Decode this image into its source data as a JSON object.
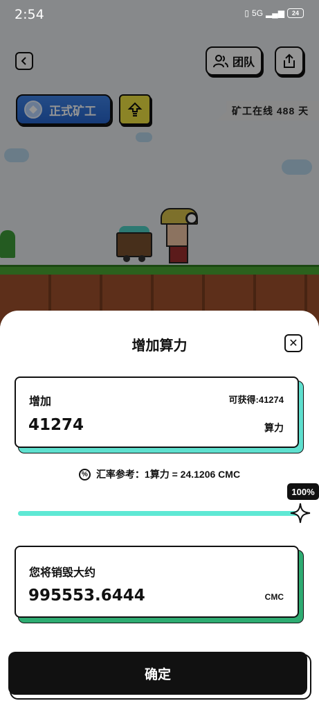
{
  "status_bar": {
    "time": "2:54",
    "network": "5G",
    "battery": "24"
  },
  "header": {
    "team_label": "团队",
    "miner_badge_label": "正式矿工",
    "online_text": "矿工在线 488 天"
  },
  "sheet": {
    "title": "增加算力",
    "add": {
      "label": "增加",
      "obtainable_text": "可获得:41274",
      "value": "41274",
      "unit": "算力"
    },
    "rate": {
      "icon": "%",
      "text": "汇率参考：1算力 = 24.1206 CMC"
    },
    "slider": {
      "percent_label": "100%",
      "value": 1.0
    },
    "burn": {
      "label": "您将销毁大约",
      "value": "995553.6444",
      "unit": "CMC"
    },
    "confirm_label": "确定"
  },
  "colors": {
    "accent_teal": "#5fe0cf",
    "accent_green": "#2eac72",
    "badge_blue": "#2f73dc",
    "upgrade_yellow": "#f0e442"
  }
}
